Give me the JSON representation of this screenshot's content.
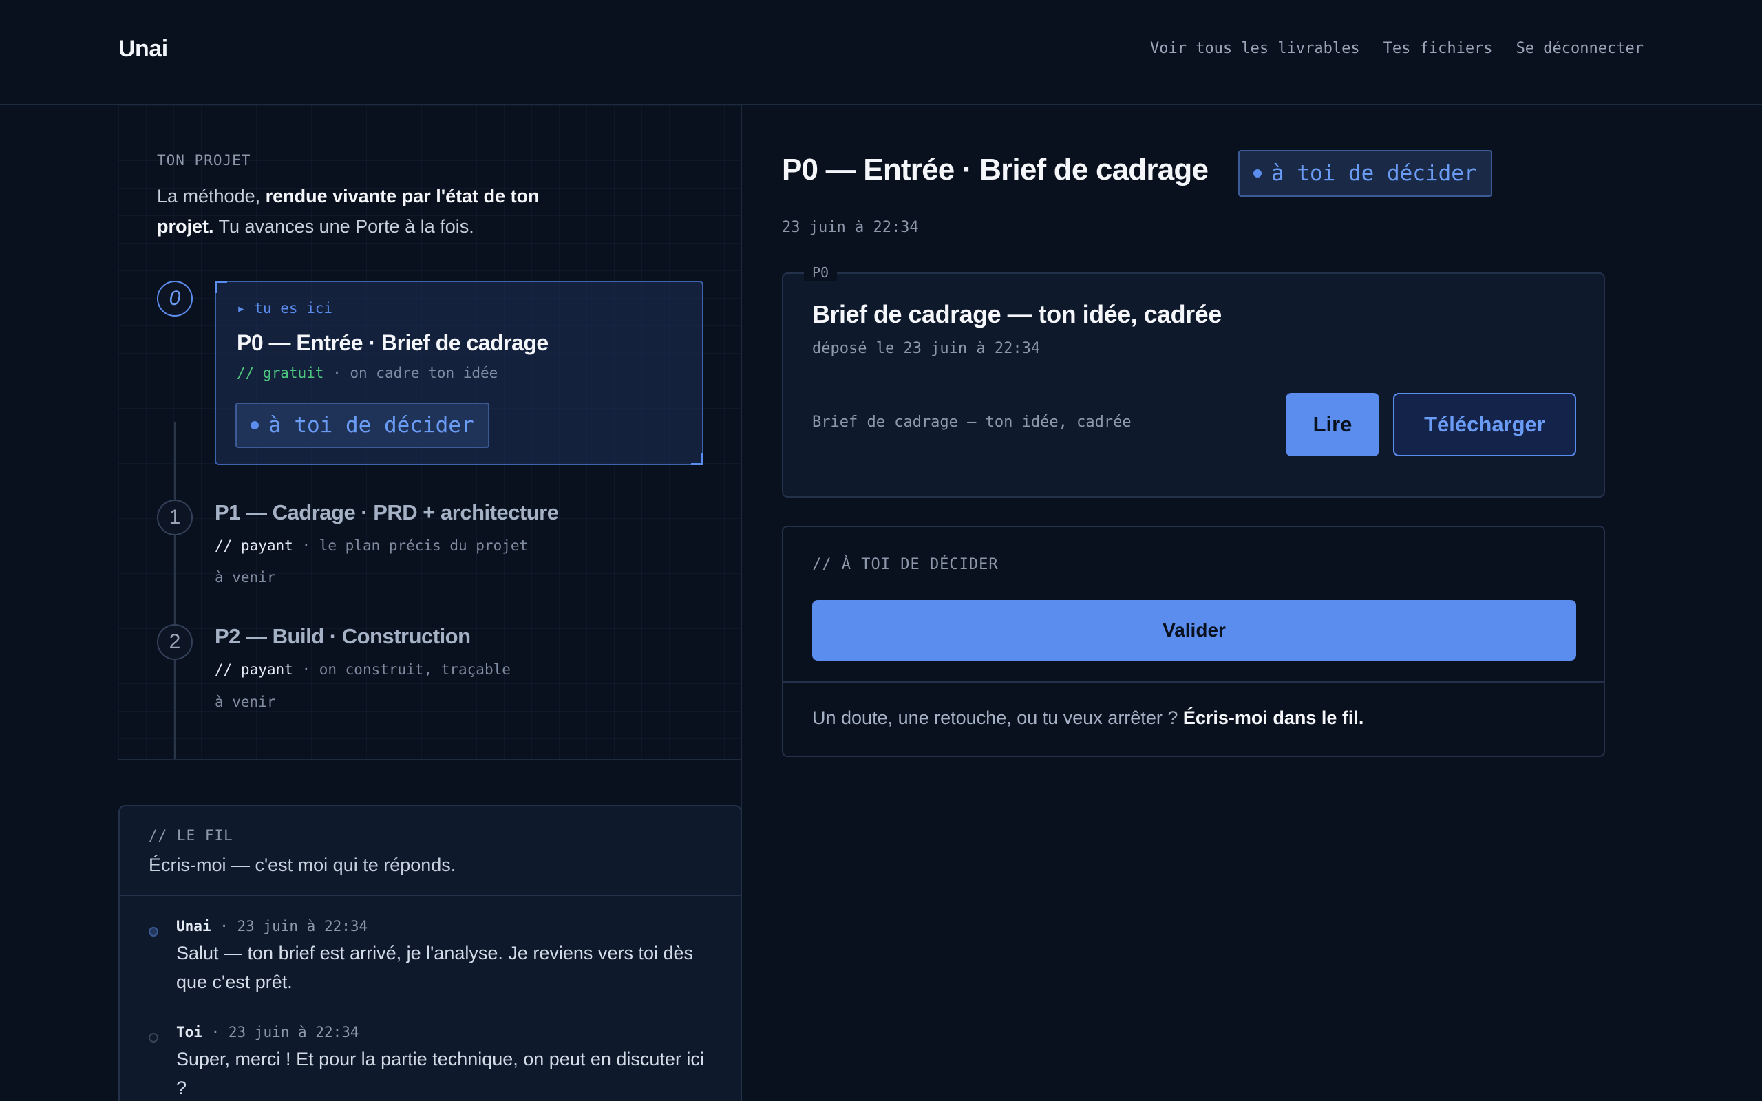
{
  "header": {
    "brand": "Unai",
    "nav": [
      "Voir tous les livrables",
      "Tes fichiers",
      "Se déconnecter"
    ]
  },
  "project": {
    "eyebrow": "TON PROJET",
    "intro_prefix": "La méthode, ",
    "intro_bold": "rendue vivante par l'état de ton projet.",
    "intro_suffix": " Tu avances une Porte à la fois.",
    "steps": [
      {
        "number": "0",
        "here_label": "▸ tu es ici",
        "title": "P0 — Entrée · Brief de cadrage",
        "price": "// gratuit",
        "desc": " · on cadre ton idée",
        "status": "à toi de décider"
      },
      {
        "number": "1",
        "title": "P1 — Cadrage · PRD + architecture",
        "price": "// payant",
        "desc": " · le plan précis du projet",
        "status": "à venir"
      },
      {
        "number": "2",
        "title": "P2 — Build · Construction",
        "price": "// payant",
        "desc": " · on construit, traçable",
        "status": "à venir"
      }
    ]
  },
  "thread": {
    "eyebrow": "// LE FIL",
    "subtitle": "Écris-moi — c'est moi qui te réponds.",
    "messages": [
      {
        "author": "Unai",
        "time": " · 23 juin à 22:34",
        "text": "Salut — ton brief est arrivé, je l'analyse. Je reviens vers toi dès que c'est prêt."
      },
      {
        "author": "Toi",
        "time": " · 23 juin à 22:34",
        "text": "Super, merci ! Et pour la partie technique, on peut en discuter ici ?"
      }
    ]
  },
  "main": {
    "title": "P0 — Entrée · Brief de cadrage",
    "status_pill": "à toi de décider",
    "date": "23 juin à 22:34",
    "doc": {
      "tag": "P0",
      "title": "Brief de cadrage — ton idée, cadrée",
      "date": "déposé le 23 juin à 22:34",
      "desc": "Brief de cadrage — ton idée, cadrée",
      "read_label": "Lire",
      "download_label": "Télécharger"
    },
    "decide": {
      "eyebrow": "// À TOI DE DÉCIDER",
      "validate_label": "Valider",
      "help_prefix": "Un doute, une retouche, ou tu veux arrêter ? ",
      "help_link": "Écris-moi dans le fil."
    }
  },
  "colors": {
    "background": "#0a111e",
    "accent": "#5b8def",
    "free_green": "#4ec77e",
    "border": "#24314a"
  }
}
